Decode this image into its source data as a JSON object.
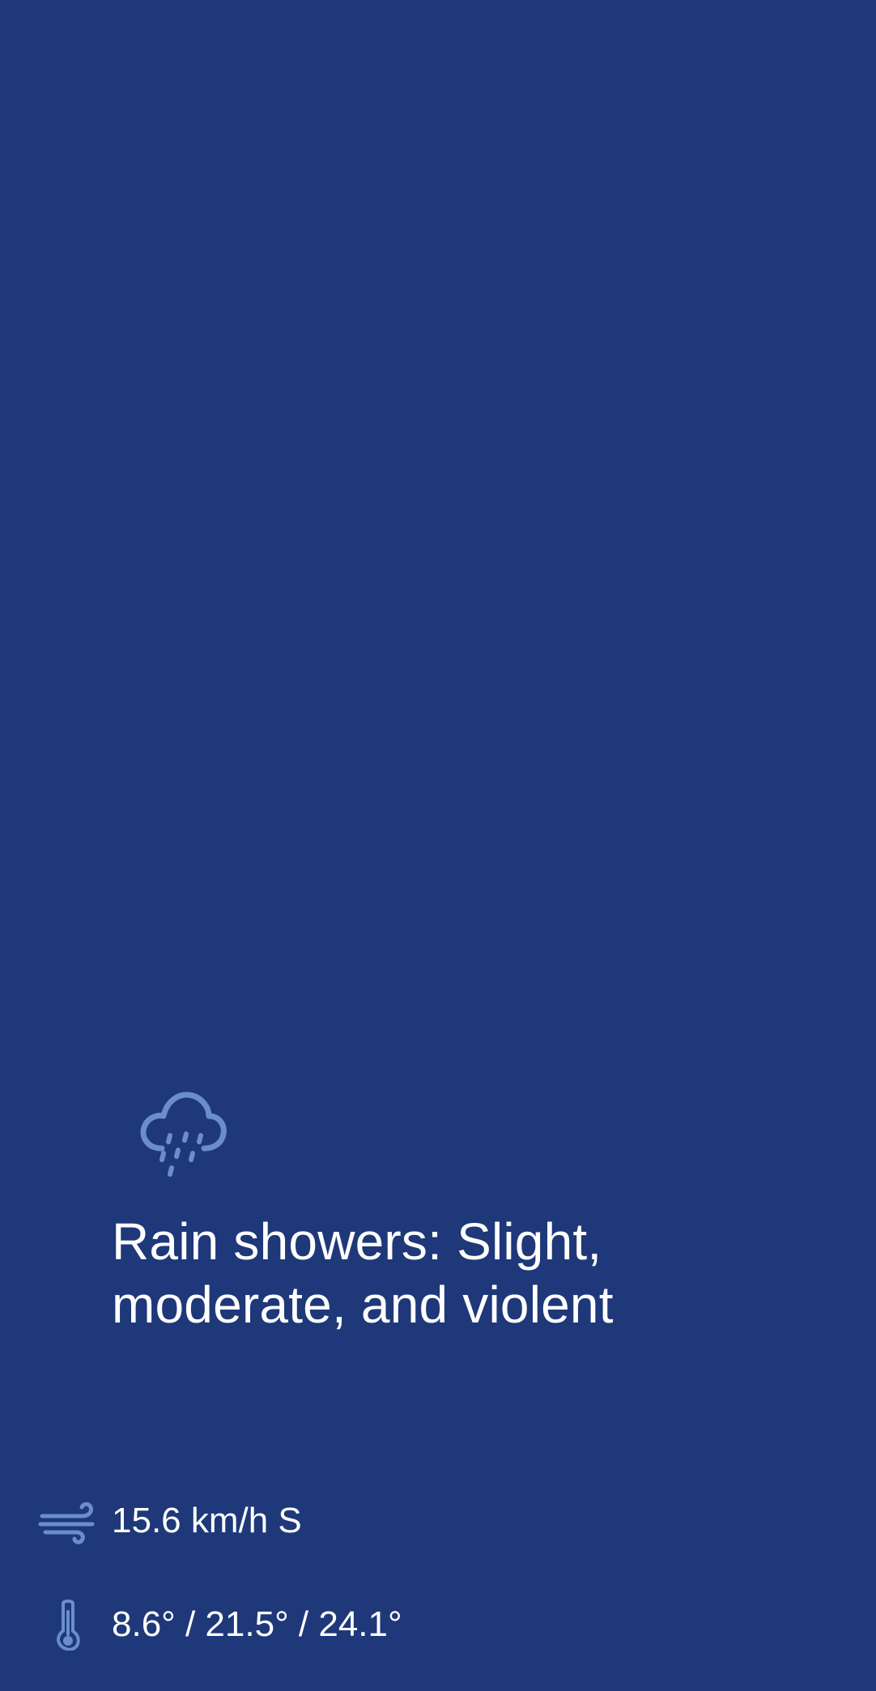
{
  "theme": {
    "background": "#1e3879",
    "icon_color": "#6b8ec9",
    "text_color": "#ffffff"
  },
  "weather": {
    "condition_icon": "rain-showers-icon",
    "condition": "Rain showers: Slight, moderate, and violent"
  },
  "details": {
    "wind": {
      "icon": "wind-icon",
      "value": "15.6 km/h S"
    },
    "temperature": {
      "icon": "thermometer-icon",
      "value": "8.6° / 21.5° / 24.1°"
    }
  }
}
